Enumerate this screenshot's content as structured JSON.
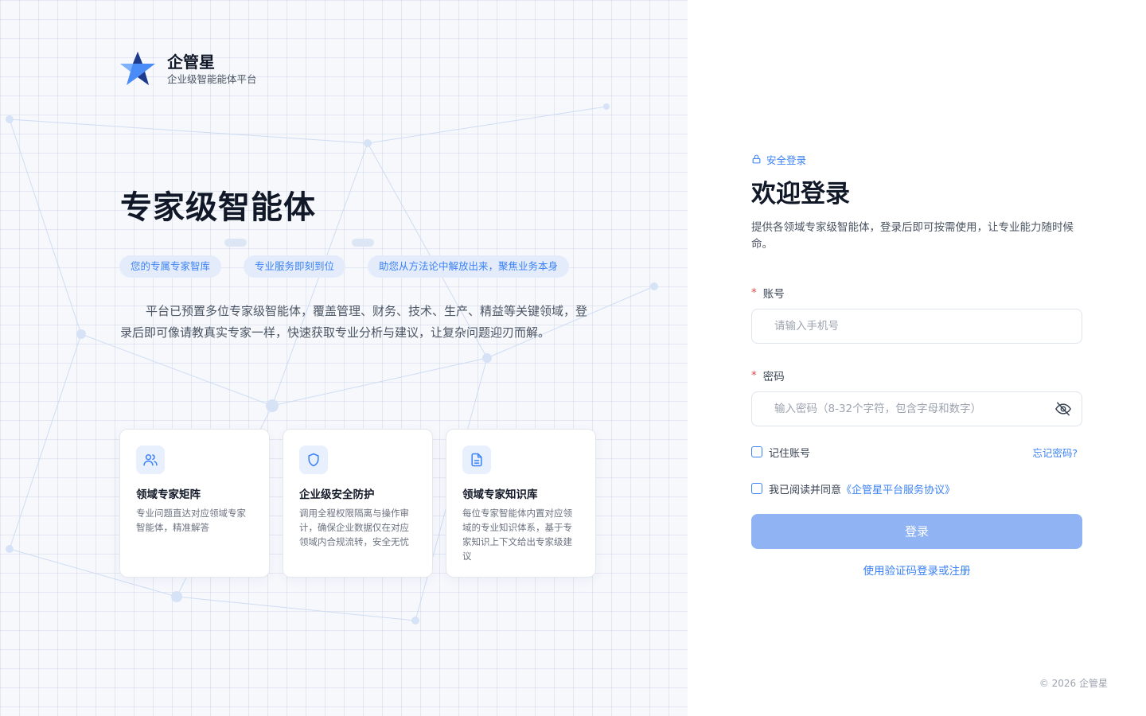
{
  "brand": {
    "name": "企管星",
    "tagline": "企业级智能能体平台"
  },
  "hero": {
    "title": "专家级智能体",
    "tags": [
      "您的专属专家智库",
      "专业服务即刻到位",
      "助您从方法论中解放出来，聚焦业务本身"
    ],
    "description": "平台已预置多位专家级智能体，覆盖管理、财务、技术、生产、精益等关键领域，登录后即可像请教真实专家一样，快速获取专业分析与建议，让复杂问题迎刃而解。"
  },
  "features": [
    {
      "icon": "users-icon",
      "title": "领域专家矩阵",
      "text": "专业问题直达对应领域专家智能体，精准解答"
    },
    {
      "icon": "shield-icon",
      "title": "企业级安全防护",
      "text": "调用全程权限隔离与操作审计，确保企业数据仅在对应领域内合规流转，安全无忧"
    },
    {
      "icon": "document-icon",
      "title": "领域专家知识库",
      "text": "每位专家智能体内置对应领域的专业知识体系，基于专家知识上下文给出专家级建议"
    }
  ],
  "login": {
    "secure_label": "安全登录",
    "title": "欢迎登录",
    "lead": "提供各领域专家级智能体，登录后即可按需使用，让专业能力随时候命。",
    "required_mark": "*",
    "account": {
      "label": "账号",
      "value": "",
      "placeholder": "请输入手机号"
    },
    "password": {
      "label": "密码",
      "value": "",
      "placeholder": "输入密码（8-32个字符，包含字母和数字）"
    },
    "remember_label": "记住账号",
    "forgot_label": "忘记密码?",
    "agree_prefix": "我已阅读并同意",
    "agree_link": "《企管星平台服务协议》",
    "submit_label": "登录",
    "alt_login_label": "使用验证码登录或注册"
  },
  "footer": {
    "copyright": "© 2026 企管星"
  },
  "colors": {
    "accent": "#3b82f6",
    "button_disabled": "#8fb3f3",
    "required": "#ef4444"
  }
}
